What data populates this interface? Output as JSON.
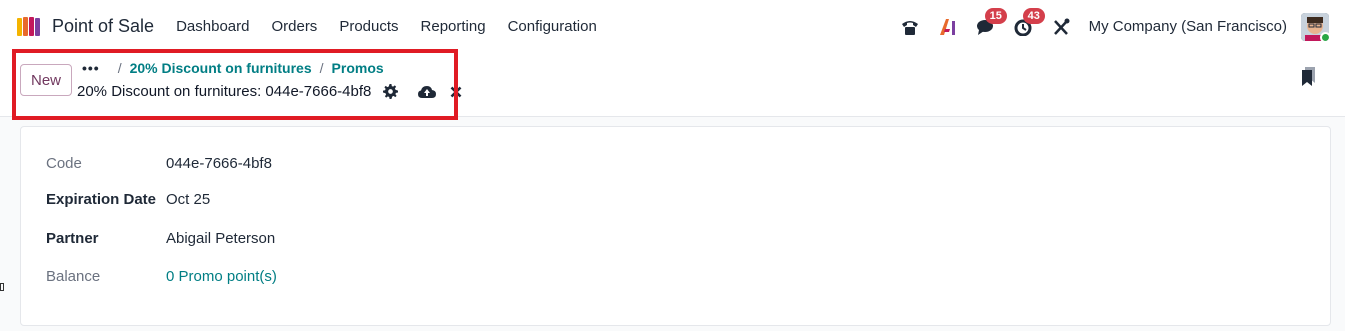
{
  "navbar": {
    "app_name": "Point of Sale",
    "menu": [
      "Dashboard",
      "Orders",
      "Products",
      "Reporting",
      "Configuration"
    ],
    "systray": {
      "chat_badge": "15",
      "activity_badge": "43",
      "company": "My Company (San Francisco)"
    }
  },
  "control_panel": {
    "new_label": "New",
    "breadcrumb": [
      "20% Discount on furnitures",
      "Promos"
    ],
    "record_title": "20% Discount on furnitures: 044e-7666-4bf8"
  },
  "form": {
    "fields": [
      {
        "label": "Code",
        "value": "044e-7666-4bf8"
      },
      {
        "label": "Expiration Date",
        "value": "Oct 25"
      },
      {
        "label": "Partner",
        "value": "Abigail Peterson"
      },
      {
        "label": "Balance",
        "value": "0 Promo point(s)"
      }
    ]
  },
  "colors": {
    "brand_purple": "#71385f",
    "link_teal": "#017e84",
    "highlight_red": "#e01b24",
    "badge_red": "#d43f4b"
  }
}
